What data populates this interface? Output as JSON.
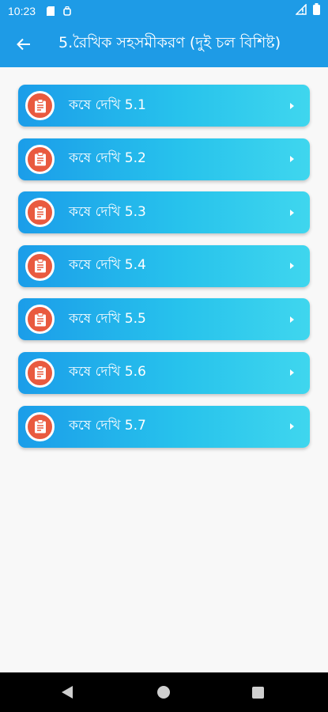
{
  "status_bar": {
    "time": "10:23"
  },
  "app_bar": {
    "title": "5.রৈখিক সহসমীকরণ (দুই চল বিশিষ্ট)",
    "back_icon": "arrow-back-icon",
    "color": "#1e9be6"
  },
  "list": {
    "items": [
      {
        "label": "কষে দেখি 5.1",
        "icon": "clipboard-icon"
      },
      {
        "label": "কষে দেখি 5.2",
        "icon": "clipboard-icon"
      },
      {
        "label": "কষে দেখি 5.3",
        "icon": "clipboard-icon"
      },
      {
        "label": "কষে দেখি 5.4",
        "icon": "clipboard-icon"
      },
      {
        "label": "কষে দেখি 5.5",
        "icon": "clipboard-icon"
      },
      {
        "label": "কষে দেখি 5.6",
        "icon": "clipboard-icon"
      },
      {
        "label": "কষে দেখি 5.7",
        "icon": "clipboard-icon"
      }
    ],
    "gradient_start": "#1b9de9",
    "gradient_end": "#3fd6ee",
    "icon_bg": "#e95a3f"
  },
  "nav_bar": {
    "back_icon": "triangle-back-icon",
    "home_icon": "circle-home-icon",
    "recents_icon": "square-recents-icon"
  }
}
